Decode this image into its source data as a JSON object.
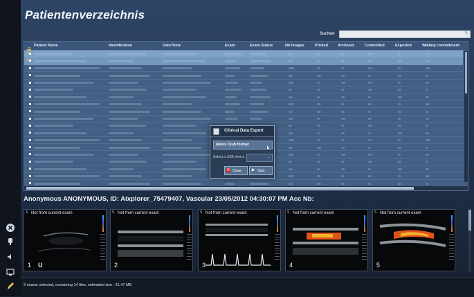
{
  "app": {
    "title": "Patientenverzeichnis"
  },
  "search": {
    "label": "Suchen",
    "value": ""
  },
  "table": {
    "columns": [
      "Patient Name",
      "Identification",
      "Date/Time",
      "Exam",
      "Exam Status",
      "Nb Images",
      "Printed",
      "Archived",
      "Committed",
      "Exported",
      "Waiting commitment"
    ],
    "row_count": 20
  },
  "dialog": {
    "title": "Clinical Data Export",
    "format_value": "Users Club format",
    "usb_label": "Select a USB device",
    "close_label": "Close",
    "start_label": "Start"
  },
  "info_bar": "Anonymous ANONYMOUS, ID: Aixplorer_75479407, Vascular 23/05/2012 04:30:07 PM Acc Nb:",
  "thumbnails": [
    {
      "label": "Not from current exam",
      "number": "1"
    },
    {
      "label": "Not from current exam",
      "number": "2"
    },
    {
      "label": "Not from current exam",
      "number": "3"
    },
    {
      "label": "Not from current exam",
      "number": "4"
    },
    {
      "label": "Not from current exam",
      "number": "5"
    }
  ],
  "status": "2 exams selected, containing 14 files, estimated size : 21.47 MB",
  "colors": {
    "accent": "#7fa2c7",
    "panel": "#445f84",
    "close_red": "#d3302a"
  }
}
